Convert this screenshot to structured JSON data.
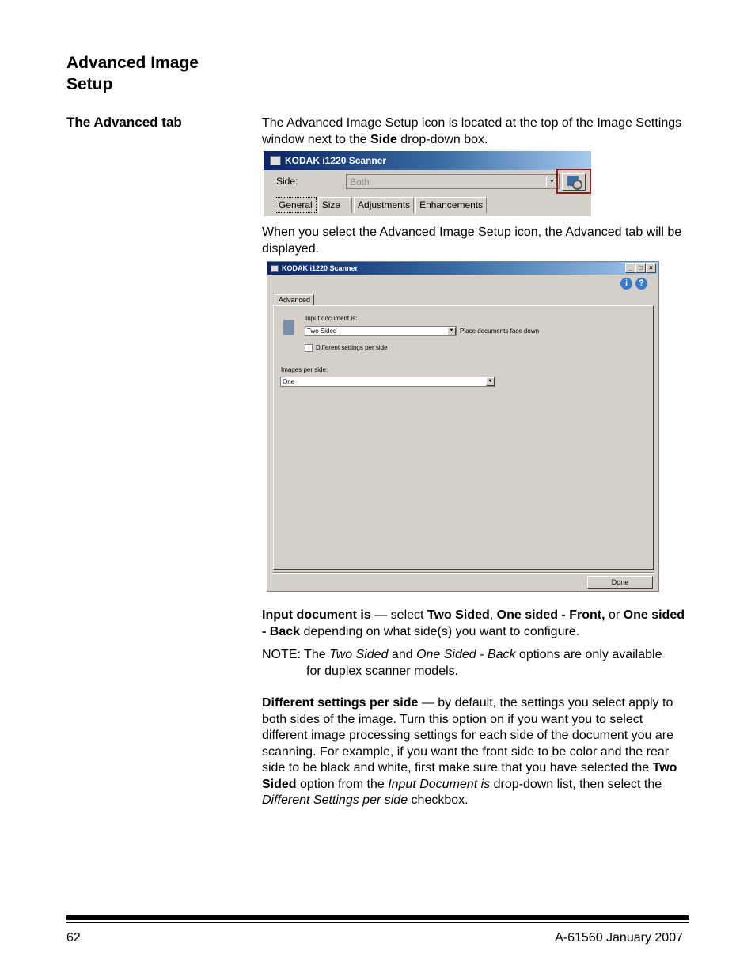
{
  "heading": {
    "section_title": "Advanced Image Setup",
    "subsection_title": "The Advanced tab"
  },
  "intro": {
    "p1_a": "The Advanced Image Setup icon is located at the top of the Image Settings window next to the ",
    "p1_bold": "Side",
    "p1_b": " drop-down box.",
    "p2": "When you select the Advanced Image Setup icon, the Advanced tab will be displayed."
  },
  "screenshot1": {
    "title": "KODAK i1220 Scanner",
    "side_label": "Side:",
    "side_value": "Both",
    "advanced_icon": "advanced-image-setup-icon",
    "tabs": [
      "General",
      "Size",
      "Adjustments",
      "Enhancements"
    ],
    "selected_tab": "General"
  },
  "screenshot2": {
    "title": "KODAK i1220 Scanner",
    "controls": {
      "minimize": "_",
      "maximize": "□",
      "close": "×"
    },
    "help_icons": [
      "info-icon",
      "help-icon"
    ],
    "tab": "Advanced",
    "input_document_label": "Input document is:",
    "input_document_value": "Two Sided",
    "place_hint": "Place documents face down",
    "different_settings_label": "Different settings per side",
    "different_settings_checked": false,
    "images_per_side_label": "Images per side:",
    "images_per_side_value": "One",
    "done_label": "Done"
  },
  "body": {
    "input_doc": {
      "b1": "Input document is",
      "t1": " — select ",
      "b2": "Two Sided",
      "t2": ", ",
      "b3": "One sided - Front,",
      "t3": " or ",
      "b4": "One sided - Back",
      "t4": " depending on what side(s) you want to configure."
    },
    "note": {
      "prefix": "NOTE: The ",
      "i1": "Two Sided",
      "t1": " and ",
      "i2": "One Sided - Back",
      "t2": " options are only available",
      "line2": "for duplex scanner models."
    },
    "diff": {
      "b1": "Different settings per side",
      "t1": " — by default, the settings you select apply to both sides of the image. Turn this option on if you want you to select different image processing settings for each side of the document you are scanning. For example, if you want the front side to be color and the rear side to be black and white, first make sure that you have selected the ",
      "b2": "Two Sided",
      "t2": " option from the ",
      "i1": "Input Document is",
      "t3": " drop-down list, then select the ",
      "i2": "Different Settings per side",
      "t4": " checkbox."
    }
  },
  "footer": {
    "page_number": "62",
    "doc_id": "A-61560 January 2007"
  }
}
